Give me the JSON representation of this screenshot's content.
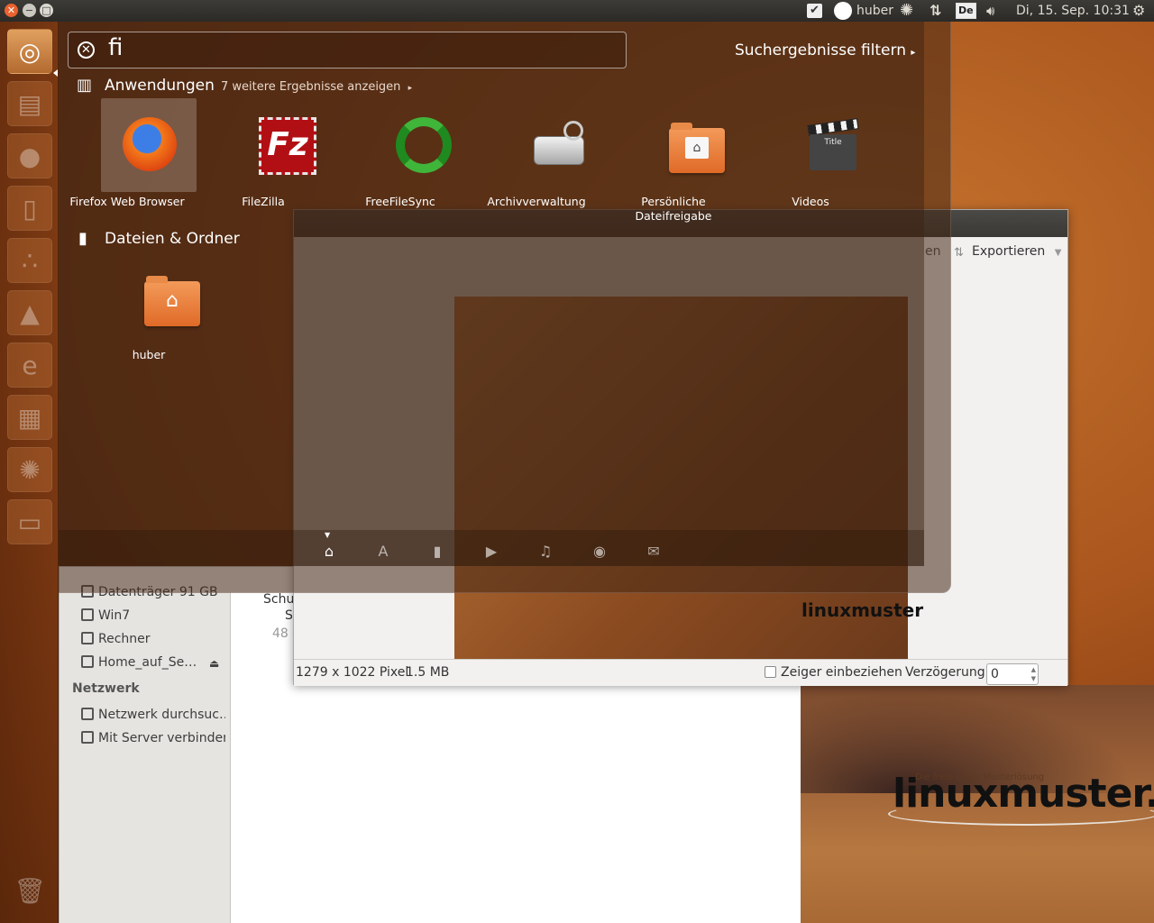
{
  "panel": {
    "user": "huber",
    "keyboard": "De",
    "clock": "Di, 15. Sep. 10:31"
  },
  "dash": {
    "search_value": "fi",
    "filter_label": "Suchergebnisse filtern",
    "applications": {
      "heading": "Anwendungen",
      "more": "7 weitere Ergebnisse anzeigen",
      "items": [
        {
          "label": "Firefox Web Browser",
          "icon": "firefox-icon"
        },
        {
          "label": "FileZilla",
          "icon": "filezilla-icon"
        },
        {
          "label": "FreeFileSync",
          "icon": "freefilesync-icon"
        },
        {
          "label": "Archivverwaltung",
          "icon": "archive-manager-icon"
        },
        {
          "label": "Persönliche Dateifreigabe",
          "icon": "file-sharing-icon"
        },
        {
          "label": "Videos",
          "icon": "videos-icon"
        }
      ]
    },
    "files": {
      "heading": "Dateien & Ordner",
      "items": [
        {
          "label": "huber",
          "icon": "home-folder-icon"
        }
      ]
    },
    "lenses": [
      "home-lens-icon",
      "applications-lens-icon",
      "files-lens-icon",
      "video-lens-icon",
      "music-lens-icon",
      "photo-lens-icon",
      "social-lens-icon"
    ]
  },
  "file_manager": {
    "sidebar": [
      {
        "label": "Datenträger 91 GB"
      },
      {
        "label": "Win7"
      },
      {
        "label": "Rechner"
      },
      {
        "label": "Home_auf_Se…"
      }
    ],
    "network_heading": "Netzwerk",
    "network_items": [
      {
        "label": "Netzwerk durchsuc…"
      },
      {
        "label": "Mit Server verbinden"
      }
    ],
    "main_text_1": "Schu",
    "main_text_2": "S",
    "main_text_3": "48"
  },
  "screenshot_tool": {
    "partial_label": "en",
    "export_label": "Exportieren",
    "status_size": "1279 x 1022 Pixel",
    "status_filesize": "1.5 MB",
    "include_pointer_label": "Zeiger einbeziehen",
    "delay_label": "Verzögerung:",
    "delay_value": "0",
    "logo_text": "linuxmuster"
  },
  "wallpaper": {
    "logo_text": "linuxmuster.n",
    "logo_tagline": "Die freie Linux Musterlösung"
  }
}
